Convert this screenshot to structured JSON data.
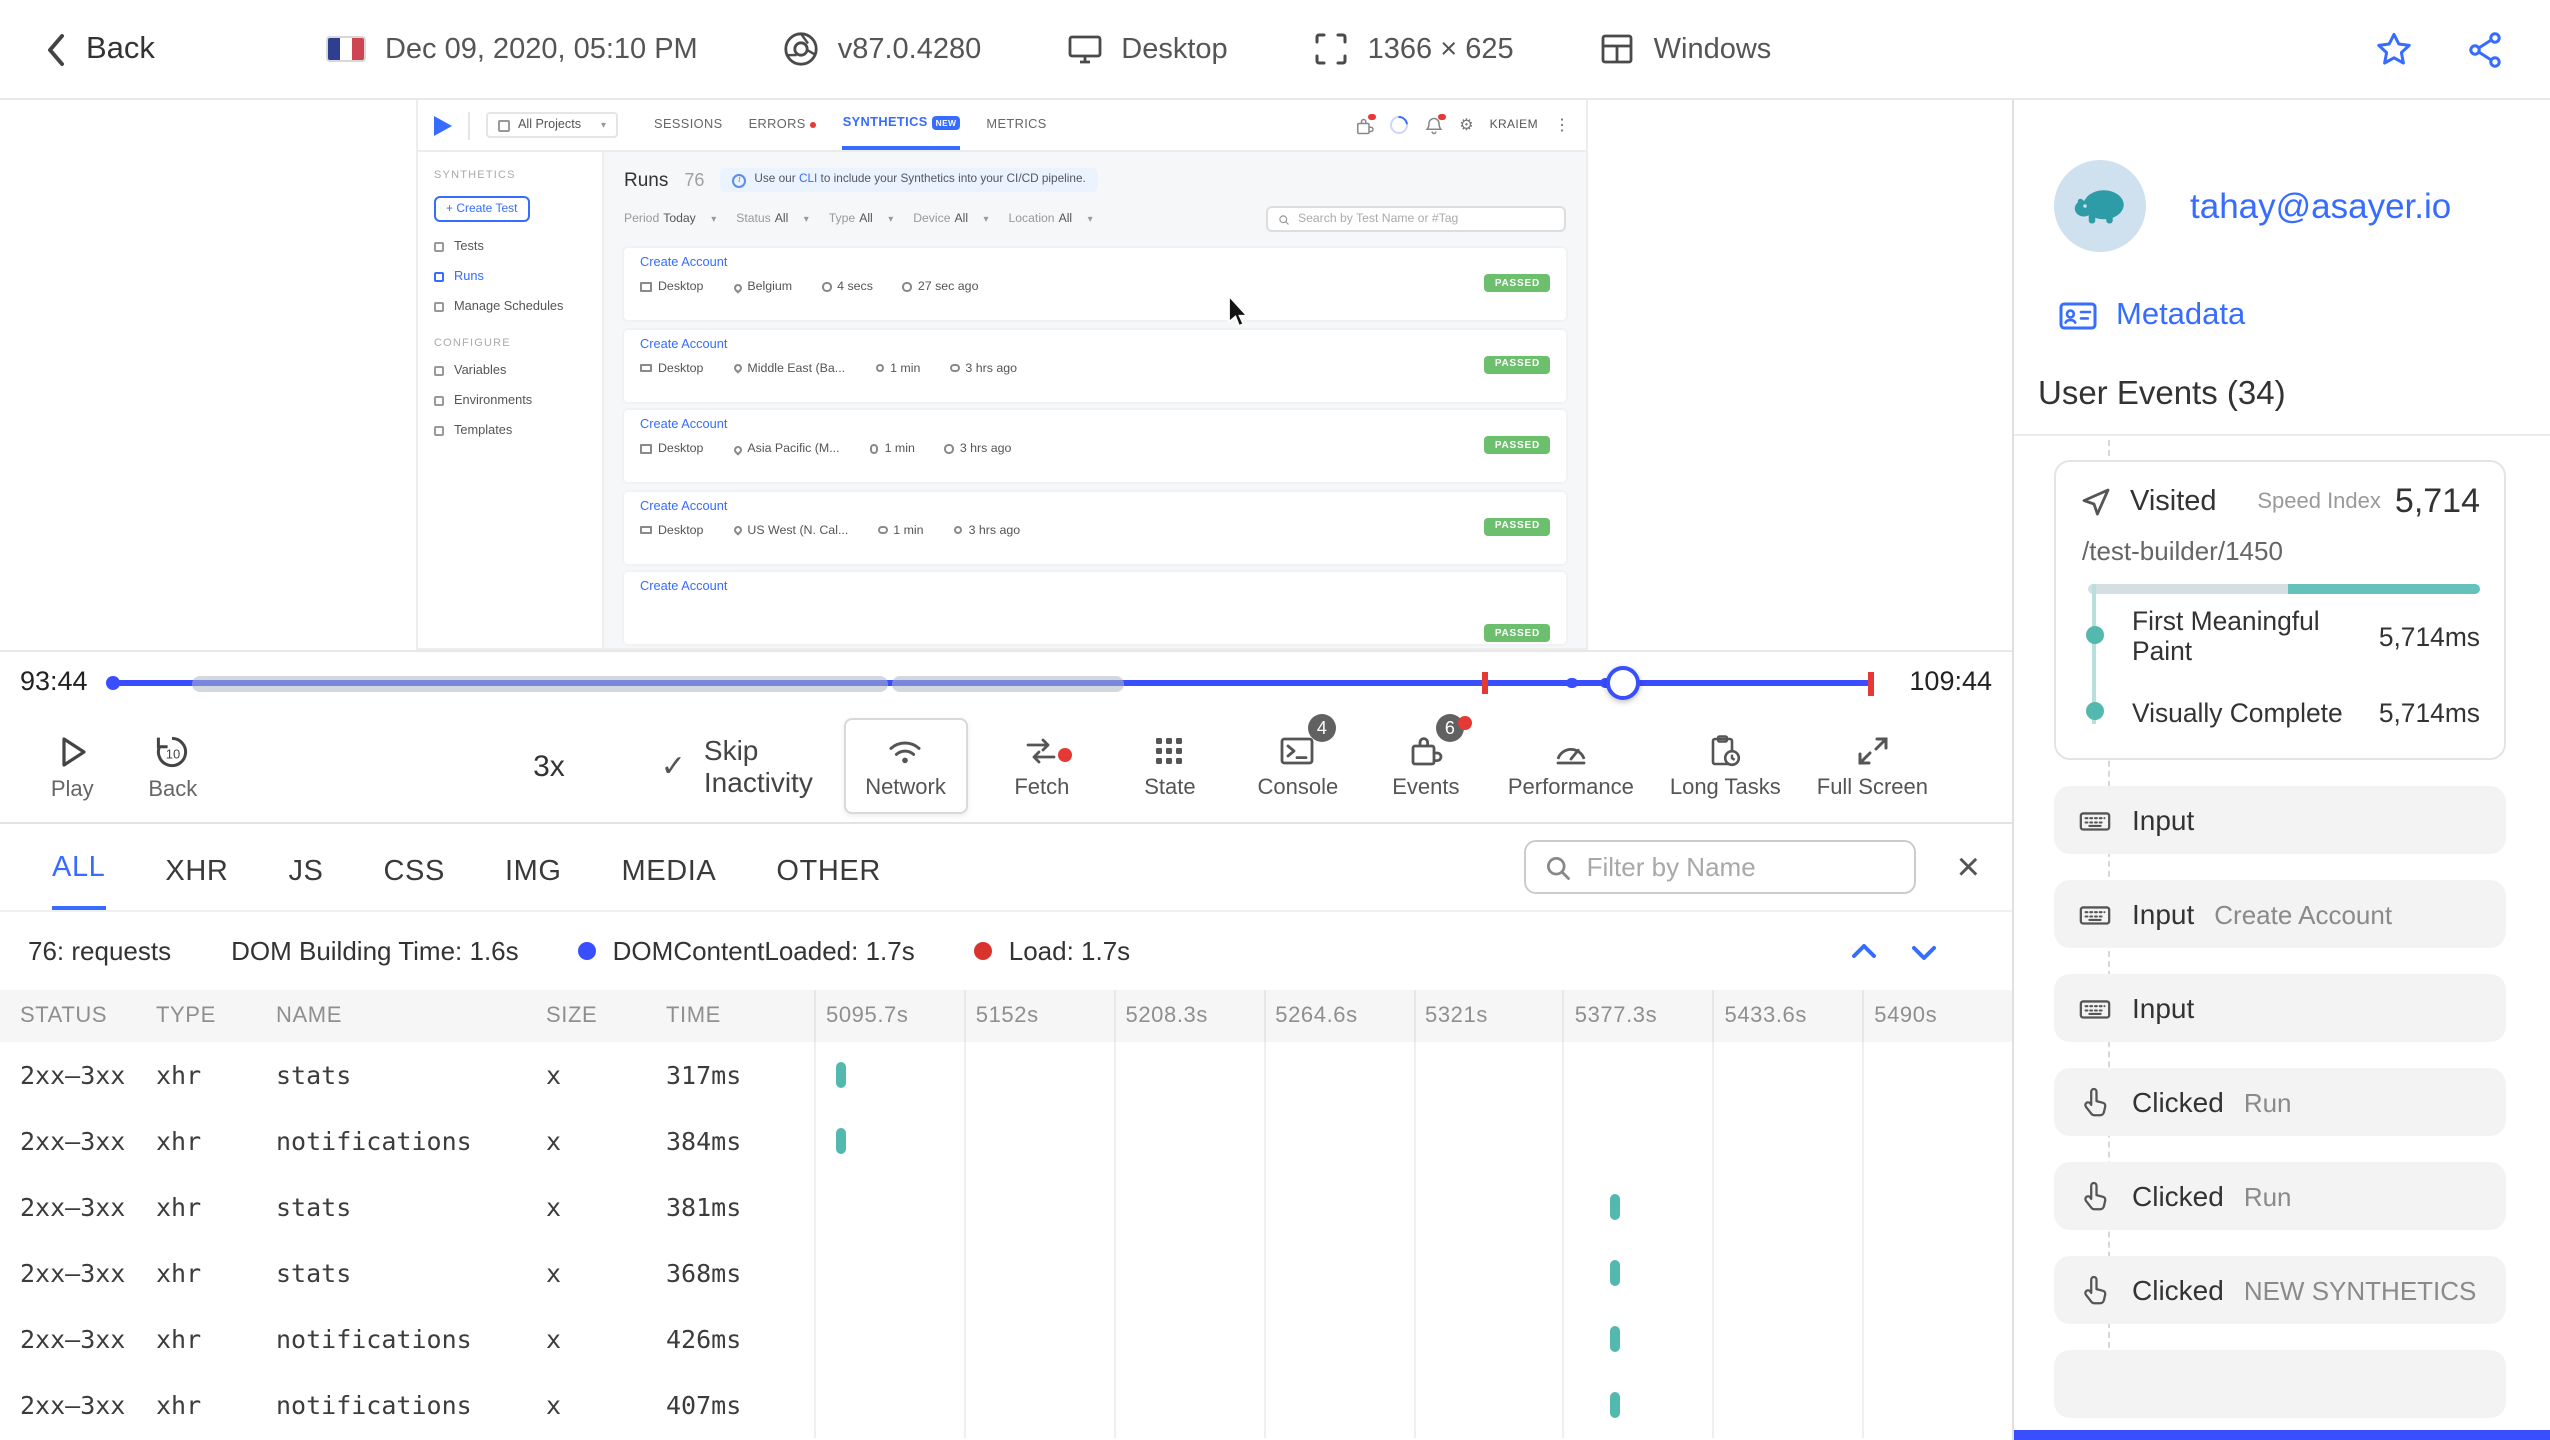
{
  "colors": {
    "accent_blue": "#394EFF",
    "link_blue": "#366CFF",
    "teal": "#53B8AE",
    "red": "#E53935",
    "green": "#6CBF6C"
  },
  "topbar": {
    "back": "Back",
    "datetime": "Dec 09, 2020, 05:10 PM",
    "browser_version": "v87.0.4280",
    "device": "Desktop",
    "resolution": "1366 × 625",
    "os": "Windows"
  },
  "app": {
    "project_selector": "All Projects",
    "tabs": {
      "sessions": "SESSIONS",
      "errors": "ERRORS",
      "synthetics": "SYNTHETICS",
      "new_badge": "NEW",
      "metrics": "METRICS"
    },
    "user": "KRAIEM",
    "sidebar": {
      "section_synthetics": "SYNTHETICS",
      "create_test": "+ Create Test",
      "tests": "Tests",
      "runs": "Runs",
      "manage_schedules": "Manage Schedules",
      "section_configure": "CONFIGURE",
      "variables": "Variables",
      "environments": "Environments",
      "templates": "Templates"
    },
    "runs_page": {
      "title": "Runs",
      "count": "76",
      "banner_pre": "Use our ",
      "banner_cli": "CLI",
      "banner_post": " to include your Synthetics into your CI/CD pipeline.",
      "filters": [
        {
          "label": "Period",
          "value": "Today"
        },
        {
          "label": "Status",
          "value": "All"
        },
        {
          "label": "Type",
          "value": "All"
        },
        {
          "label": "Device",
          "value": "All"
        },
        {
          "label": "Location",
          "value": "All"
        }
      ],
      "search_placeholder": "Search by Test Name or #Tag",
      "rows": [
        {
          "name": "Create Account",
          "device": "Desktop",
          "location": "Belgium",
          "duration": "4 secs",
          "ago": "27 sec ago",
          "status": "PASSED"
        },
        {
          "name": "Create Account",
          "device": "Desktop",
          "location": "Middle East (Ba...",
          "duration": "1 min",
          "ago": "3 hrs ago",
          "status": "PASSED"
        },
        {
          "name": "Create Account",
          "device": "Desktop",
          "location": "Asia Pacific (M...",
          "duration": "1 min",
          "ago": "3 hrs ago",
          "status": "PASSED"
        },
        {
          "name": "Create Account",
          "device": "Desktop",
          "location": "US West (N. Cal...",
          "duration": "1 min",
          "ago": "3 hrs ago",
          "status": "PASSED"
        },
        {
          "name": "Create Account",
          "device": "",
          "location": "",
          "duration": "",
          "ago": "",
          "status": "PASSED"
        }
      ]
    }
  },
  "player": {
    "time_start": "93:44",
    "time_end": "109:44",
    "play": "Play",
    "back": "Back",
    "back_amount": "10",
    "speed": "3x",
    "skip_check": "✓",
    "skip_inactivity": "Skip Inactivity",
    "panels": [
      {
        "label": "Network"
      },
      {
        "label": "Fetch"
      },
      {
        "label": "State"
      },
      {
        "label": "Console",
        "badge": "4"
      },
      {
        "label": "Events",
        "badge": "6"
      },
      {
        "label": "Performance"
      },
      {
        "label": "Long Tasks"
      },
      {
        "label": "Full Screen"
      }
    ]
  },
  "network": {
    "tabs": [
      "ALL",
      "XHR",
      "JS",
      "CSS",
      "IMG",
      "MEDIA",
      "OTHER"
    ],
    "filter_placeholder": "Filter by Name",
    "close": "×",
    "summary": {
      "requests": "76: requests",
      "dom_building": "DOM Building Time: 1.6s",
      "dom_content_loaded": "DOMContentLoaded: 1.7s",
      "load": "Load: 1.7s"
    },
    "headers": [
      "STATUS",
      "TYPE",
      "NAME",
      "SIZE",
      "TIME"
    ],
    "time_cols": [
      "5095.7s",
      "5152s",
      "5208.3s",
      "5264.6s",
      "5321s",
      "5377.3s",
      "5433.6s",
      "5490s"
    ],
    "rows": [
      {
        "status": "2xx–3xx",
        "type": "xhr",
        "name": "stats",
        "size": "x",
        "time": "317ms",
        "tick_pct": 1.8
      },
      {
        "status": "2xx–3xx",
        "type": "xhr",
        "name": "notifications",
        "size": "x",
        "time": "384ms",
        "tick_pct": 1.8
      },
      {
        "status": "2xx–3xx",
        "type": "xhr",
        "name": "stats",
        "size": "x",
        "time": "381ms",
        "tick_pct": 66.5
      },
      {
        "status": "2xx–3xx",
        "type": "xhr",
        "name": "stats",
        "size": "x",
        "time": "368ms",
        "tick_pct": 66.5
      },
      {
        "status": "2xx–3xx",
        "type": "xhr",
        "name": "notifications",
        "size": "x",
        "time": "426ms",
        "tick_pct": 66.5
      },
      {
        "status": "2xx–3xx",
        "type": "xhr",
        "name": "notifications",
        "size": "x",
        "time": "407ms",
        "tick_pct": 66.5
      }
    ]
  },
  "user_panel": {
    "email": "tahay@asayer.io",
    "metadata": "Metadata",
    "events_heading": "User Events (34)",
    "visited": {
      "label": "Visited",
      "speed_index_label": "Speed Index",
      "speed_index": "5,714",
      "url": "/test-builder/1450",
      "metrics": [
        {
          "label": "First Meaningful Paint",
          "value": "5,714ms"
        },
        {
          "label": "Visually Complete",
          "value": "5,714ms"
        }
      ]
    },
    "events": [
      {
        "type": "input",
        "label": "Input",
        "value": ""
      },
      {
        "type": "input",
        "label": "Input",
        "value": "Create Account"
      },
      {
        "type": "input",
        "label": "Input",
        "value": ""
      },
      {
        "type": "click",
        "label": "Clicked",
        "value": "Run"
      },
      {
        "type": "click",
        "label": "Clicked",
        "value": "Run"
      },
      {
        "type": "click",
        "label": "Clicked",
        "value": "NEW SYNTHETICS"
      }
    ]
  }
}
